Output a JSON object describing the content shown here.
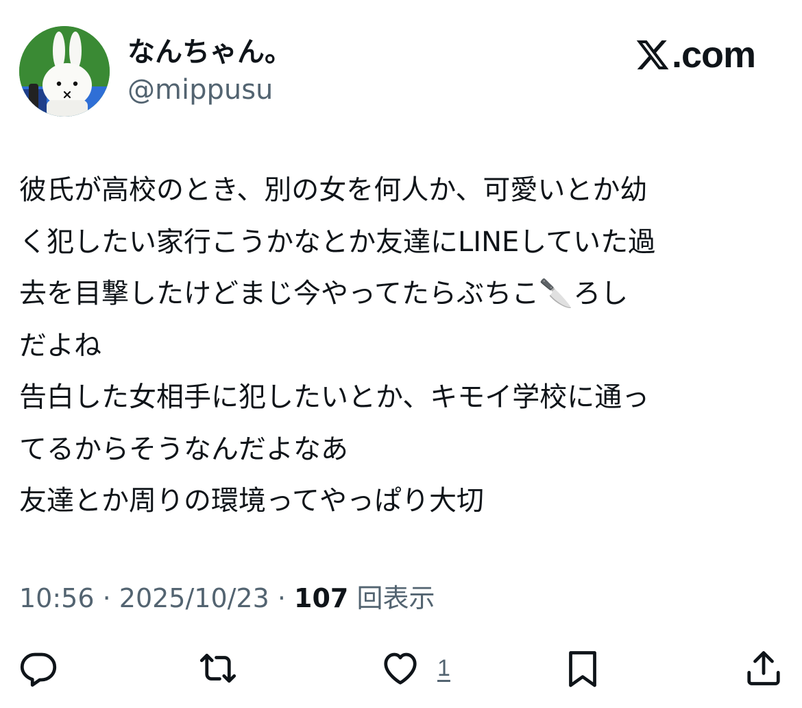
{
  "brand": {
    "logo_text": ".com"
  },
  "author": {
    "display_name": "なんちゃん。",
    "handle": "@mippusu",
    "avatar_icon": "miffy-avatar-icon"
  },
  "tweet": {
    "lines": [
      "彼氏が高校のとき、別の女を何人か、可愛いとか幼",
      "く犯したい家行こうかなとか友達にLINEしていた過",
      "去を目撃したけどまじ今やってたらぶちこ🔪ろし",
      "だよね",
      "告白した女相手に犯したいとか、キモイ学校に通っ",
      "てるからそうなんだよなあ",
      "友達とか周りの環境ってやっぱり大切"
    ]
  },
  "meta": {
    "time": "10:56",
    "separator": " · ",
    "date": "2025/10/23",
    "views_count": "107",
    "views_label": "回表示"
  },
  "actions": {
    "reply_icon": "reply-icon",
    "retweet_icon": "retweet-icon",
    "like_icon": "heart-icon",
    "like_count": "1",
    "bookmark_icon": "bookmark-icon",
    "share_icon": "share-icon"
  },
  "colors": {
    "text_primary": "#0f1419",
    "text_secondary": "#536471",
    "background": "#ffffff"
  }
}
